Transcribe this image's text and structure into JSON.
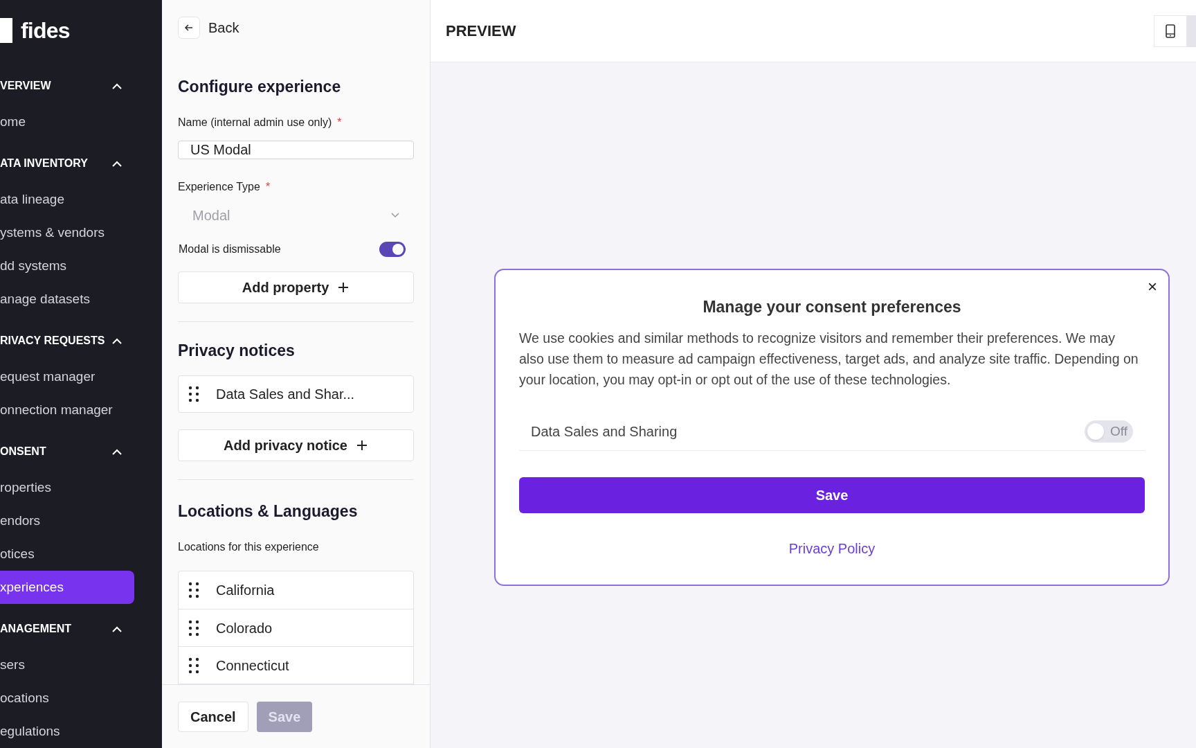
{
  "sidebar": {
    "logo": "fides",
    "sections": [
      {
        "title": "VERVIEW",
        "expanded": true,
        "items": [
          {
            "label": "ome",
            "selected": false
          }
        ]
      },
      {
        "title": "ATA INVENTORY",
        "expanded": true,
        "items": [
          {
            "label": "ata lineage",
            "selected": false
          },
          {
            "label": "ystems & vendors",
            "selected": false
          },
          {
            "label": "dd systems",
            "selected": false
          },
          {
            "label": "anage datasets",
            "selected": false
          }
        ]
      },
      {
        "title": "RIVACY REQUESTS",
        "expanded": true,
        "items": [
          {
            "label": "equest manager",
            "selected": false
          },
          {
            "label": "onnection manager",
            "selected": false
          }
        ]
      },
      {
        "title": "ONSENT",
        "expanded": true,
        "items": [
          {
            "label": "roperties",
            "selected": false
          },
          {
            "label": "endors",
            "selected": false
          },
          {
            "label": "otices",
            "selected": false
          },
          {
            "label": "xperiences",
            "selected": true
          }
        ]
      },
      {
        "title": "ANAGEMENT",
        "expanded": true,
        "items": [
          {
            "label": "sers",
            "selected": false
          },
          {
            "label": "ocations",
            "selected": false
          },
          {
            "label": "egulations",
            "selected": false
          }
        ]
      }
    ]
  },
  "form": {
    "back": "Back",
    "title": "Configure experience",
    "name_field": {
      "label": "Name (internal admin use only)",
      "required_mark": "*",
      "value": "US Modal"
    },
    "type_field": {
      "label": "Experience Type",
      "required_mark": "*",
      "value": "Modal",
      "disabled": true
    },
    "dismissable": {
      "label": "Modal is dismissable",
      "on": true
    },
    "add_property": "Add property",
    "notices_title": "Privacy notices",
    "notices": [
      "Data Sales and Shar..."
    ],
    "add_notice": "Add privacy notice",
    "locations_title": "Locations & Languages",
    "locations_label": "Locations for this experience",
    "locations": [
      "California",
      "Colorado",
      "Connecticut"
    ],
    "cancel": "Cancel",
    "save": {
      "label": "Save",
      "disabled": true
    }
  },
  "preview": {
    "title": "PREVIEW",
    "modal": {
      "title": "Manage your consent preferences",
      "close": "×",
      "description": "We use cookies and similar methods to recognize visitors and remember their preferences. We may also use them to measure ad campaign effectiveness, target ads, and analyze site traffic. Depending on your location, you may opt-in or opt out of the use of these technologies.",
      "notices": [
        {
          "label": "Data Sales and Sharing",
          "on": false,
          "state_label": "Off"
        }
      ],
      "save": "Save",
      "privacy_link": "Privacy Policy"
    }
  }
}
